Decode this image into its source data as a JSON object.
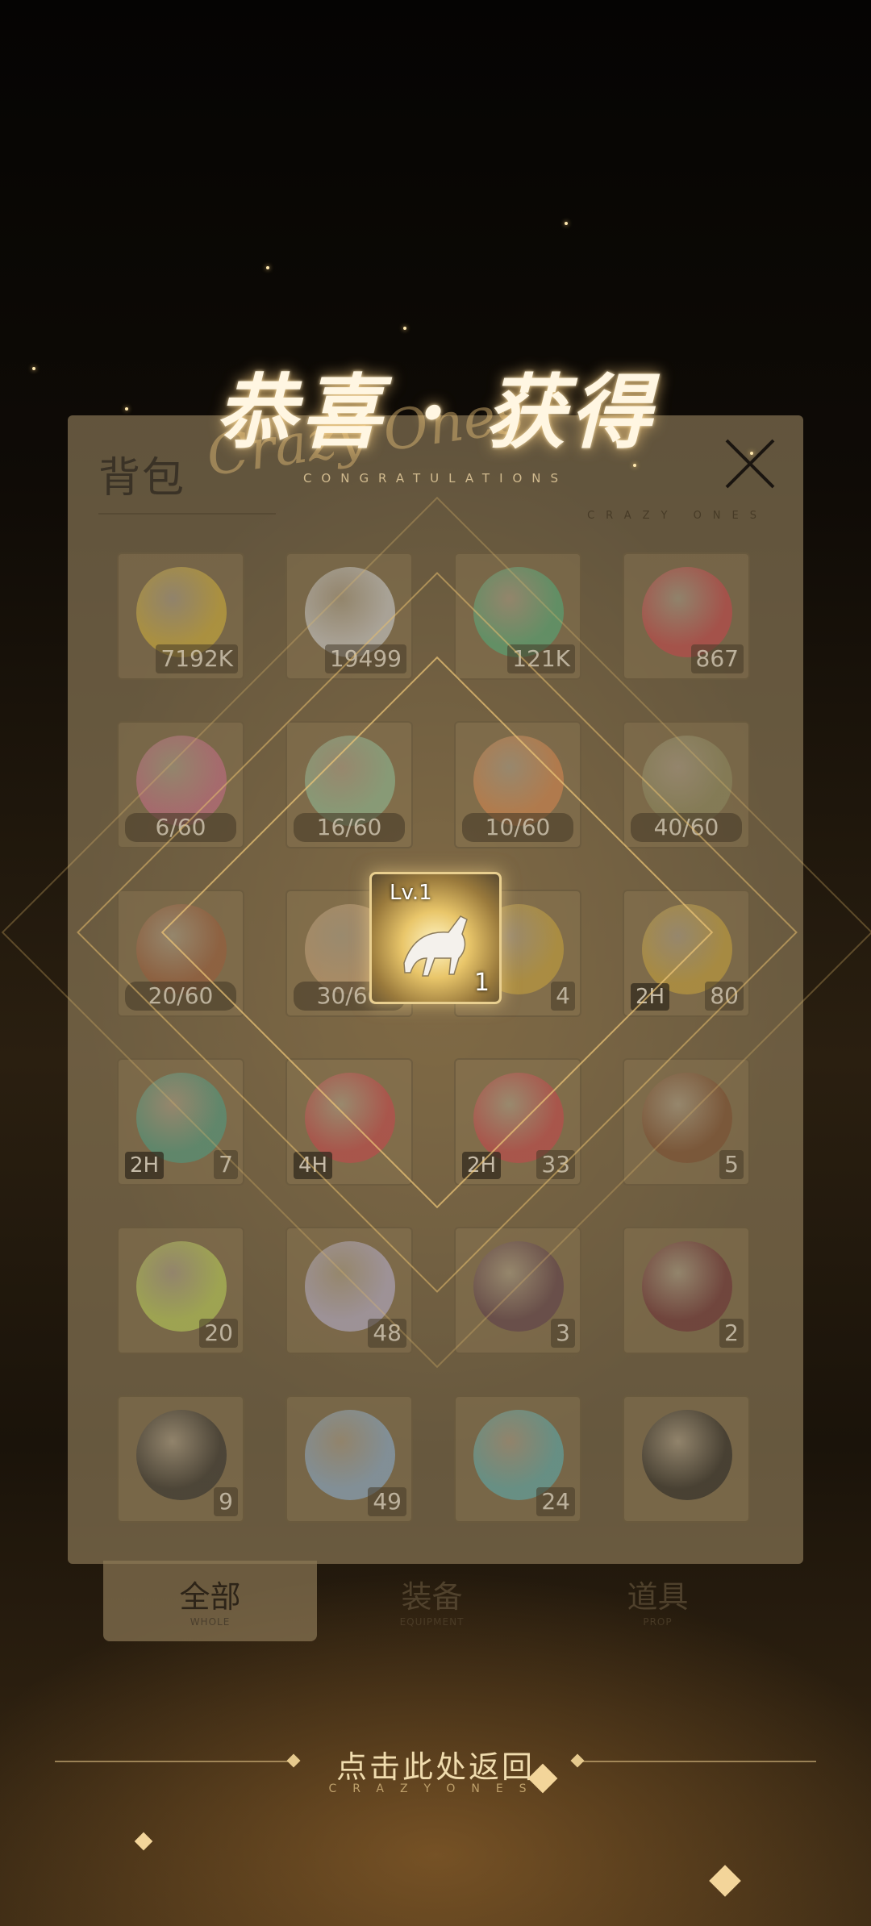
{
  "congrats": {
    "title": "恭喜 · 获得",
    "subtitle": "CONGRATULATIONS",
    "script": "Crazy Ones"
  },
  "panel": {
    "title": "背包",
    "brand": "CRAZY ONES"
  },
  "reward": {
    "level": "Lv.1",
    "count": "1",
    "icon": "horse-icon"
  },
  "inventory": {
    "items": [
      {
        "icon": "gold-coin-icon",
        "qty": "7192K",
        "color": "#d4b33a"
      },
      {
        "icon": "crystal-icon",
        "qty": "19499",
        "color": "#cfd2d6"
      },
      {
        "icon": "exp-coin-icon",
        "qty": "121K",
        "color": "#4fae7c"
      },
      {
        "icon": "red-cube-icon",
        "qty": "867",
        "color": "#c9434c"
      },
      {
        "icon": "pink-shard-icon",
        "frag": "6/60",
        "color": "#c86c8a"
      },
      {
        "icon": "green-shard-icon",
        "frag": "16/60",
        "color": "#8fbf9a"
      },
      {
        "icon": "orange-shard-icon",
        "frag": "10/60",
        "color": "#d9874f"
      },
      {
        "icon": "character-shard-icon",
        "frag": "40/60",
        "color": "#8c8a60"
      },
      {
        "icon": "character-shard-icon",
        "frag": "20/60",
        "color": "#9a5a3a"
      },
      {
        "icon": "character-shard-icon",
        "frag": "30/60",
        "color": "#c7a37a"
      },
      {
        "icon": "gold-coins-icon",
        "qty": "4",
        "color": "#caa53c"
      },
      {
        "icon": "gold-coins-icon",
        "time": "2H",
        "qty": "80",
        "color": "#caa53c"
      },
      {
        "icon": "exp-coins-icon",
        "time": "2H",
        "qty": "7",
        "color": "#4a9e86"
      },
      {
        "icon": "red-cubes-icon",
        "time": "4H",
        "color": "#c9434c"
      },
      {
        "icon": "red-cubes-icon",
        "time": "2H",
        "qty": "33",
        "color": "#c9434c"
      },
      {
        "icon": "shop-building-icon",
        "qty": "5",
        "color": "#7a4a2e"
      },
      {
        "icon": "star-gem-icon",
        "qty": "20",
        "color": "#bcd45a"
      },
      {
        "icon": "prism-icon",
        "qty": "48",
        "color": "#b9b3d6"
      },
      {
        "icon": "ticket-icon",
        "qty": "3",
        "color": "#5a3a4a"
      },
      {
        "icon": "ticket-icon",
        "qty": "2",
        "color": "#6a2a34"
      },
      {
        "icon": "drink-can-icon",
        "qty": "9",
        "color": "#2a2a2a"
      },
      {
        "icon": "card-icon",
        "qty": "49",
        "color": "#8ab0d6"
      },
      {
        "icon": "vs-card-icon",
        "qty": "24",
        "color": "#5ab0b4"
      },
      {
        "icon": "name-card-icon",
        "color": "#222222"
      }
    ]
  },
  "tabs": [
    {
      "label": "全部",
      "sub": "WHOLE",
      "active": true
    },
    {
      "label": "装备",
      "sub": "EQUIPMENT",
      "active": false
    },
    {
      "label": "道具",
      "sub": "PROP",
      "active": false
    }
  ],
  "back": {
    "label": "点击此处返回",
    "sub": "CRAZYONES"
  }
}
